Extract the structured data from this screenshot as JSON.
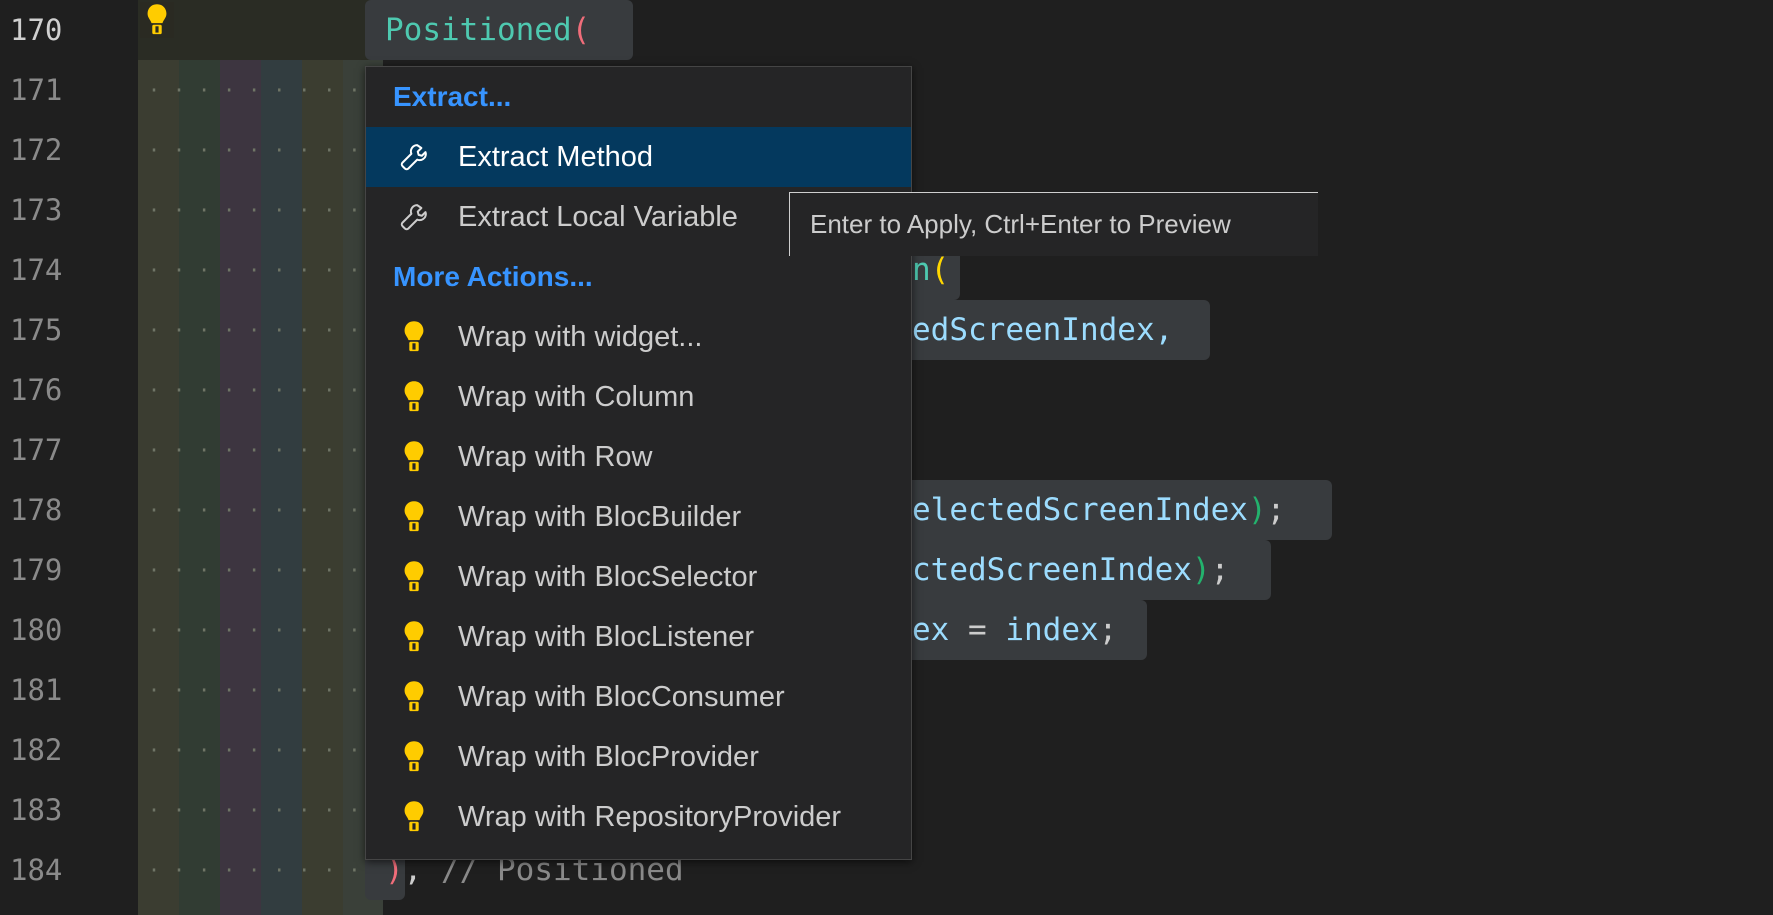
{
  "editor": {
    "line_numbers": [
      "170",
      "171",
      "172",
      "173",
      "174",
      "175",
      "176",
      "177",
      "178",
      "179",
      "180",
      "181",
      "182",
      "183",
      "184"
    ],
    "active_line": "170",
    "code": {
      "l170_name": "Positioned",
      "l170_paren": "(",
      "l174_text": "n",
      "l174_paren": "(",
      "l175_text": "edScreenIndex,",
      "l178_text": "electedScreenIndex",
      "l178_close": ")",
      "l178_semi": ";",
      "l179_text": "ctedScreenIndex",
      "l179_close": ")",
      "l179_semi": ";",
      "l180_a": "ex",
      "l180_op": " = ",
      "l180_b": "index",
      "l180_semi": ";",
      "l184_paren": ")",
      "l184_comma": ",",
      "l184_comment": " // Positioned"
    }
  },
  "code_actions_menu": {
    "sections": [
      {
        "header": "Extract...",
        "items": [
          {
            "label": "Extract Method",
            "icon": "wrench-icon",
            "selected": true
          },
          {
            "label": "Extract Local Variable",
            "icon": "wrench-icon",
            "selected": false
          }
        ]
      },
      {
        "header": "More Actions...",
        "items": [
          {
            "label": "Wrap with widget...",
            "icon": "lightbulb-icon"
          },
          {
            "label": "Wrap with Column",
            "icon": "lightbulb-icon"
          },
          {
            "label": "Wrap with Row",
            "icon": "lightbulb-icon"
          },
          {
            "label": "Wrap with BlocBuilder",
            "icon": "lightbulb-icon"
          },
          {
            "label": "Wrap with BlocSelector",
            "icon": "lightbulb-icon"
          },
          {
            "label": "Wrap with BlocListener",
            "icon": "lightbulb-icon"
          },
          {
            "label": "Wrap with BlocConsumer",
            "icon": "lightbulb-icon"
          },
          {
            "label": "Wrap with BlocProvider",
            "icon": "lightbulb-icon"
          },
          {
            "label": "Wrap with RepositoryProvider",
            "icon": "lightbulb-icon"
          }
        ]
      }
    ]
  },
  "tooltip": {
    "text": "Enter to Apply, Ctrl+Enter to Preview"
  },
  "colors": {
    "accent": "#3794ff",
    "selection": "#04395e",
    "lightbulb": "#ffcc00",
    "type": "#4ec9b0",
    "identifier": "#9cdcfe"
  }
}
